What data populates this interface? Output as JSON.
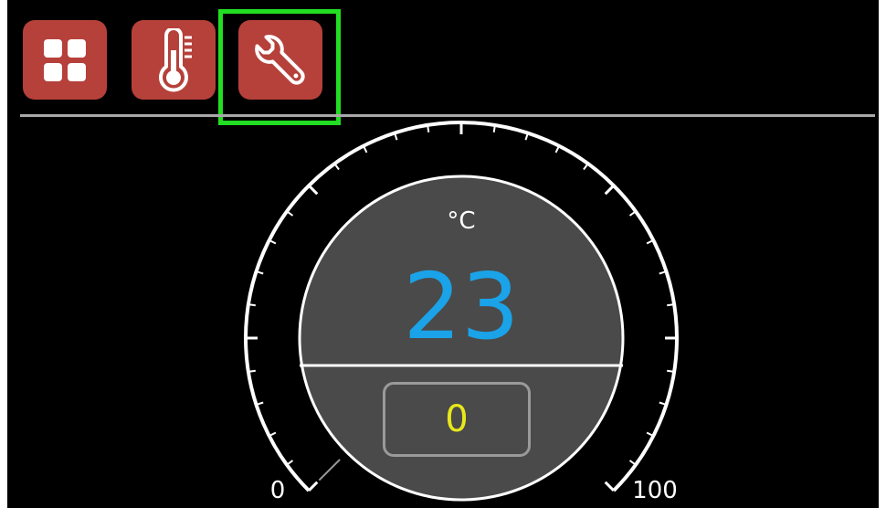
{
  "toolbar": {
    "tabs": [
      {
        "id": "dashboard",
        "icon": "grid-icon"
      },
      {
        "id": "temperature",
        "icon": "thermometer-icon"
      },
      {
        "id": "settings",
        "icon": "wrench-icon",
        "selected": true
      }
    ]
  },
  "gauge": {
    "unit": "°C",
    "value": "23",
    "min_label": "0",
    "max_label": "100",
    "min": 0,
    "max": 100,
    "current": 23,
    "setpoint_value": "0",
    "setpoint": 0
  },
  "colors": {
    "background": "#000000",
    "button": "#b5413a",
    "highlight": "#22dd22",
    "value_text": "#1aa3e8",
    "setpoint_text": "#e8e81a",
    "dial_face": "#4a4a4a",
    "divider": "#a8a8a8"
  }
}
